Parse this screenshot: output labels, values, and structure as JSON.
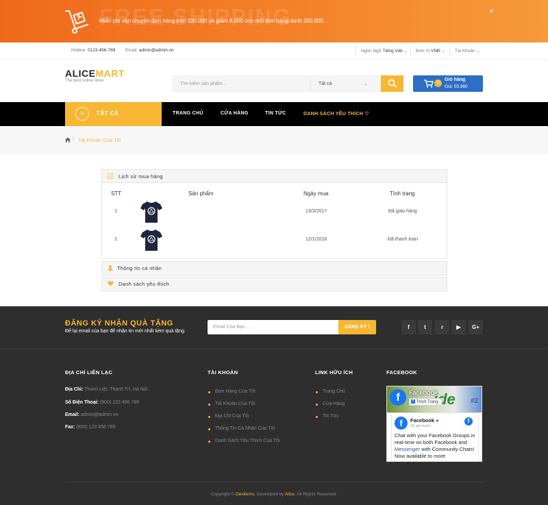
{
  "promo": {
    "watermark": "FREE SHIPPING",
    "message": "Miễn phí vận chuyển đơn hàng trên 200.000 và giảm 8.000 cho mỗi đơn hàng dưới 200.000.",
    "close": "×"
  },
  "topbar": {
    "hotline_label": "Hotline:",
    "hotline": "0123-456-789",
    "email_label": "Email:",
    "email": "admin@admin.vn",
    "language_label": "Ngôn Ngữ",
    "language": "Tiếng Việt",
    "currency_label": "Đơn Vị",
    "currency": "VNĐ",
    "account": "Tài Khoản"
  },
  "header": {
    "logo_a": "ALICE",
    "logo_b": "MART",
    "tagline": "The best online store",
    "search_placeholder": "Tìm kiếm sản phẩm...",
    "search_category": "Tất cả",
    "cart_title": "Giỏ hàng",
    "cart_count": "0",
    "cart_total": "Giá: 55.980"
  },
  "nav": {
    "all": "TẤT CẢ",
    "items": [
      "TRANG CHỦ",
      "CỬA HÀNG",
      "TIN TỨC",
      "DANH SÁCH YÊU THÍCH"
    ]
  },
  "breadcrumb": {
    "current": "Tài Khoản Của Tôi",
    "sep": "/"
  },
  "panels": {
    "history_title": "Lịch sử mua hàng",
    "info_title": "Thông tin cá nhân",
    "wishlist_title": "Danh sách yêu thích",
    "columns": [
      "STT",
      "Sản phẩm",
      "Ngày mua",
      "Tình trạng"
    ],
    "rows": [
      {
        "stt": "1",
        "date": "13/3/2017",
        "status": "Đã giao hàng"
      },
      {
        "stt": "2",
        "date": "12/1/2018",
        "status": "Đã thanh toán"
      }
    ]
  },
  "newsletter": {
    "title": "ĐĂNG KÝ NHẬN QUÀ TẶNG",
    "subtitle": "Để lại email của bạn để nhận tin mới nhất kèm quà tặng.",
    "placeholder": "Email Của Bạn...",
    "button": "ĐĂNG KÝ !",
    "socials": [
      "facebook-icon",
      "twitter-icon",
      "rss-icon",
      "youtube-icon",
      "google-plus-icon"
    ],
    "social_glyphs": [
      "f",
      "t",
      "r",
      "▶",
      "G+"
    ]
  },
  "footer": {
    "contact_title": "ĐỊA CHỈ LIÊN LẠC",
    "address_label": "Địa Chỉ:",
    "address": "Thanh Liệt, Thanh Trì, Hà Nội.",
    "phone_label": "Số Điện Thoại:",
    "phone": "(800) 123 456 789",
    "email_label": "Email:",
    "email": "admin@admin.vn",
    "fax_label": "Fax:",
    "fax": "(800) 123 456 789",
    "account_title": "TÀI KHOẢN",
    "account_links": [
      "Đơn Hàng Của Tôi",
      "Tài Khoản Của Tôi",
      "Địa Chỉ Của Tôi",
      "Thông Tin Cá Nhân Của Tôi",
      "Danh Sách Yêu Thích Của Tôi"
    ],
    "links_title": "LINK HỮU ÍCH",
    "useful_links": [
      "Trang Chủ",
      "Cửa Hàng",
      "Tin Tức"
    ],
    "facebook_title": "FACEBOOK",
    "fb_page": "Facebook",
    "fb_like": "Thích Trang",
    "fb_cover_word": "ide",
    "fb_cover_num": "#2",
    "fb_post_name": "Facebook",
    "fb_post_time": "23 giờ trước",
    "fb_post_text_1": "Chat with your Facebook Groups in real-time on both Facebook and ",
    "fb_post_link": "Messenger",
    "fb_post_text_2": " with Community Chats! Now available to more",
    "copyright_pre": "Copyright © ",
    "copyright_brand": "Devitems",
    "copyright_mid": ". Developed by ",
    "copyright_author": "Alice",
    "copyright_post": ". All Rights Reserved."
  },
  "colors": {
    "accent": "#f7b733",
    "promo": "#f0691b",
    "cart": "#2c6fc5",
    "footer": "#2e2e2e"
  }
}
